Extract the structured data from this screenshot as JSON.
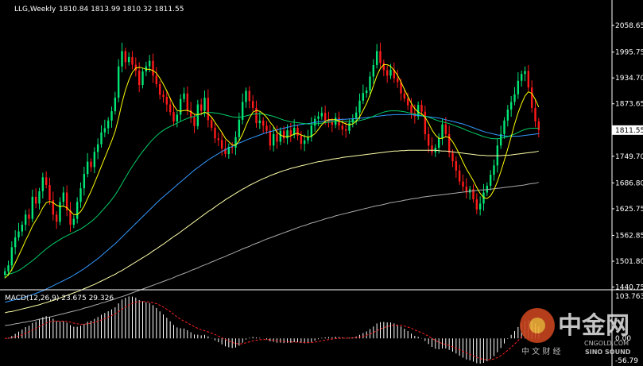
{
  "chart_data": {
    "type": "candlestick",
    "symbol": "LLG,Weekly",
    "ohlc_text": "1810.84 1813.99 1810.32 1811.55",
    "current_price_label": "1811.55",
    "price_ylim": [
      1440,
      2085
    ],
    "price_ticks": [
      "2058.65",
      "1995.75",
      "1934.70",
      "1873.65",
      "1749.70",
      "1686.80",
      "1625.75",
      "1562.85",
      "1501.80",
      "1440.75"
    ],
    "closes": [
      1478,
      1492,
      1535,
      1558,
      1572,
      1588,
      1612,
      1602,
      1654,
      1638,
      1667,
      1700,
      1682,
      1646,
      1612,
      1595,
      1642,
      1664,
      1622,
      1588,
      1602,
      1642,
      1674,
      1708,
      1737,
      1724,
      1760,
      1778,
      1806,
      1816,
      1834,
      1856,
      1888,
      1962,
      1998,
      1972,
      1984,
      1966,
      1952,
      1918,
      1950,
      1962,
      1975,
      1940,
      1920,
      1895,
      1890,
      1872,
      1854,
      1832,
      1848,
      1885,
      1898,
      1858,
      1842,
      1821,
      1872,
      1857,
      1888,
      1835,
      1817,
      1792,
      1788,
      1768,
      1755,
      1772,
      1770,
      1795,
      1836,
      1878,
      1904,
      1880,
      1864,
      1828,
      1834,
      1822,
      1810,
      1775,
      1802,
      1784,
      1810,
      1792,
      1811,
      1800,
      1817,
      1798,
      1779,
      1787,
      1795,
      1822,
      1838,
      1844,
      1852,
      1835,
      1832,
      1824,
      1841,
      1822,
      1813,
      1810,
      1829,
      1838,
      1853,
      1881,
      1899,
      1905,
      1938,
      1965,
      1998,
      1970,
      1953,
      1940,
      1954,
      1934,
      1925,
      1898,
      1886,
      1870,
      1852,
      1844,
      1871,
      1855,
      1802,
      1775,
      1759,
      1770,
      1793,
      1825,
      1802,
      1758,
      1738,
      1716,
      1690,
      1678,
      1664,
      1672,
      1648,
      1624,
      1638,
      1664,
      1680,
      1706,
      1728,
      1775,
      1802,
      1834,
      1860,
      1878,
      1896,
      1928,
      1944,
      1951,
      1912,
      1864,
      1832,
      1811.55
    ],
    "ma_short": [
      1462,
      1470,
      1482,
      1498,
      1515,
      1532,
      1551,
      1567,
      1585,
      1599,
      1612,
      1628,
      1640,
      1643,
      1640,
      1634,
      1631,
      1632,
      1628,
      1620,
      1612,
      1612,
      1619,
      1632,
      1650,
      1667,
      1686,
      1706,
      1726,
      1746,
      1766,
      1786,
      1808,
      1840,
      1876,
      1906,
      1930,
      1948,
      1958,
      1960,
      1958,
      1955,
      1955,
      1952,
      1946,
      1934,
      1920,
      1904,
      1886,
      1870,
      1858,
      1856,
      1858,
      1858,
      1855,
      1849,
      1848,
      1850,
      1854,
      1850,
      1842,
      1830,
      1818,
      1806,
      1792,
      1784,
      1776,
      1776,
      1786,
      1802,
      1822,
      1840,
      1854,
      1858,
      1856,
      1850,
      1842,
      1830,
      1820,
      1806,
      1800,
      1796,
      1796,
      1798,
      1802,
      1804,
      1800,
      1797,
      1795,
      1797,
      1803,
      1813,
      1824,
      1832,
      1836,
      1836,
      1836,
      1833,
      1830,
      1826,
      1824,
      1826,
      1832,
      1843,
      1858,
      1874,
      1894,
      1916,
      1940,
      1957,
      1966,
      1966,
      1962,
      1953,
      1941,
      1925,
      1908,
      1891,
      1875,
      1862,
      1854,
      1850,
      1842,
      1828,
      1812,
      1800,
      1792,
      1792,
      1796,
      1794,
      1784,
      1770,
      1754,
      1736,
      1720,
      1706,
      1692,
      1676,
      1662,
      1652,
      1650,
      1656,
      1670,
      1690,
      1714,
      1740,
      1767,
      1796,
      1826,
      1852,
      1874,
      1892,
      1902,
      1898,
      1884,
      1866
    ],
    "ma_medium": [
      1470,
      1471,
      1473,
      1476,
      1480,
      1485,
      1491,
      1497,
      1503,
      1510,
      1517,
      1524,
      1531,
      1537,
      1543,
      1548,
      1553,
      1558,
      1562,
      1566,
      1570,
      1574,
      1578,
      1583,
      1589,
      1595,
      1602,
      1610,
      1619,
      1628,
      1637,
      1647,
      1658,
      1671,
      1685,
      1699,
      1713,
      1726,
      1738,
      1750,
      1761,
      1771,
      1781,
      1790,
      1798,
      1805,
      1811,
      1816,
      1820,
      1824,
      1828,
      1832,
      1836,
      1839,
      1842,
      1844,
      1847,
      1849,
      1852,
      1853,
      1853,
      1852,
      1851,
      1849,
      1847,
      1845,
      1843,
      1842,
      1842,
      1843,
      1845,
      1847,
      1849,
      1850,
      1850,
      1849,
      1848,
      1846,
      1844,
      1841,
      1838,
      1835,
      1833,
      1831,
      1830,
      1829,
      1828,
      1827,
      1826,
      1826,
      1826,
      1827,
      1828,
      1829,
      1830,
      1831,
      1832,
      1832,
      1832,
      1832,
      1832,
      1832,
      1833,
      1834,
      1836,
      1838,
      1841,
      1844,
      1848,
      1851,
      1854,
      1856,
      1857,
      1857,
      1857,
      1856,
      1855,
      1853,
      1851,
      1849,
      1848,
      1846,
      1844,
      1842,
      1839,
      1836,
      1833,
      1831,
      1829,
      1827,
      1824,
      1821,
      1818,
      1815,
      1811,
      1808,
      1805,
      1802,
      1799,
      1796,
      1794,
      1792,
      1791,
      1791,
      1792,
      1794,
      1796,
      1799,
      1802,
      1806,
      1810,
      1813,
      1815,
      1816,
      1816,
      1816
    ],
    "ma_long1": [
      1405,
      1407,
      1409,
      1411,
      1413,
      1415,
      1418,
      1420,
      1423,
      1426,
      1429,
      1432,
      1436,
      1440,
      1444,
      1448,
      1452,
      1456,
      1460,
      1464,
      1469,
      1474,
      1479,
      1484,
      1490,
      1496,
      1502,
      1508,
      1515,
      1522,
      1529,
      1536,
      1543,
      1551,
      1559,
      1567,
      1575,
      1583,
      1591,
      1599,
      1607,
      1615,
      1623,
      1631,
      1639,
      1647,
      1654,
      1661,
      1668,
      1675,
      1682,
      1689,
      1696,
      1703,
      1710,
      1717,
      1723,
      1729,
      1735,
      1741,
      1746,
      1751,
      1756,
      1761,
      1765,
      1769,
      1773,
      1777,
      1781,
      1784,
      1788,
      1791,
      1794,
      1797,
      1800,
      1803,
      1806,
      1808,
      1810,
      1812,
      1814,
      1816,
      1818,
      1820,
      1822,
      1823,
      1825,
      1826,
      1827,
      1828,
      1830,
      1831,
      1832,
      1833,
      1834,
      1835,
      1836,
      1836,
      1837,
      1837,
      1838,
      1838,
      1839,
      1840,
      1840,
      1841,
      1842,
      1843,
      1844,
      1845,
      1846,
      1847,
      1847,
      1848,
      1848,
      1848,
      1848,
      1848,
      1848,
      1847,
      1846,
      1845,
      1844,
      1843,
      1842,
      1841,
      1840,
      1838,
      1836,
      1834,
      1832,
      1830,
      1828,
      1826,
      1823,
      1820,
      1817,
      1814,
      1811,
      1808,
      1806,
      1804,
      1802,
      1800,
      1799,
      1798,
      1797,
      1797,
      1797,
      1797,
      1798,
      1799,
      1800,
      1801,
      1802,
      1803
    ],
    "ma_long2": [
      1380,
      1382,
      1383,
      1385,
      1387,
      1389,
      1391,
      1393,
      1395,
      1397,
      1399,
      1402,
      1404,
      1407,
      1409,
      1412,
      1415,
      1418,
      1421,
      1424,
      1427,
      1430,
      1433,
      1437,
      1440,
      1444,
      1447,
      1451,
      1455,
      1459,
      1463,
      1467,
      1471,
      1476,
      1480,
      1485,
      1490,
      1495,
      1500,
      1505,
      1510,
      1515,
      1520,
      1526,
      1531,
      1537,
      1542,
      1548,
      1554,
      1560,
      1565,
      1571,
      1577,
      1583,
      1589,
      1595,
      1601,
      1607,
      1613,
      1619,
      1624,
      1630,
      1636,
      1641,
      1647,
      1652,
      1657,
      1662,
      1667,
      1672,
      1676,
      1681,
      1685,
      1689,
      1693,
      1697,
      1700,
      1704,
      1707,
      1710,
      1713,
      1716,
      1718,
      1721,
      1723,
      1725,
      1727,
      1729,
      1731,
      1733,
      1735,
      1737,
      1738,
      1740,
      1741,
      1743,
      1744,
      1745,
      1747,
      1748,
      1749,
      1750,
      1751,
      1752,
      1753,
      1754,
      1755,
      1756,
      1757,
      1758,
      1759,
      1760,
      1761,
      1762,
      1762,
      1763,
      1763,
      1764,
      1764,
      1764,
      1764,
      1764,
      1764,
      1764,
      1764,
      1764,
      1763,
      1762,
      1762,
      1761,
      1760,
      1759,
      1758,
      1757,
      1756,
      1755,
      1754,
      1753,
      1752,
      1752,
      1751,
      1751,
      1751,
      1751,
      1751,
      1752,
      1752,
      1753,
      1754,
      1755,
      1756,
      1757,
      1758,
      1759,
      1760,
      1762
    ],
    "ma_long3": [
      1350,
      1351,
      1352,
      1354,
      1355,
      1357,
      1358,
      1360,
      1361,
      1363,
      1365,
      1366,
      1368,
      1370,
      1372,
      1374,
      1376,
      1378,
      1380,
      1382,
      1384,
      1386,
      1388,
      1391,
      1393,
      1395,
      1398,
      1400,
      1403,
      1405,
      1408,
      1410,
      1413,
      1416,
      1418,
      1421,
      1424,
      1427,
      1430,
      1433,
      1436,
      1439,
      1442,
      1445,
      1448,
      1451,
      1454,
      1457,
      1460,
      1463,
      1467,
      1470,
      1473,
      1476,
      1480,
      1483,
      1486,
      1490,
      1493,
      1496,
      1500,
      1503,
      1507,
      1510,
      1513,
      1517,
      1520,
      1524,
      1527,
      1531,
      1534,
      1537,
      1541,
      1544,
      1547,
      1551,
      1554,
      1557,
      1560,
      1563,
      1566,
      1569,
      1572,
      1575,
      1578,
      1581,
      1584,
      1586,
      1589,
      1592,
      1594,
      1597,
      1599,
      1602,
      1604,
      1606,
      1609,
      1611,
      1613,
      1615,
      1617,
      1619,
      1621,
      1623,
      1625,
      1627,
      1629,
      1631,
      1633,
      1634,
      1636,
      1638,
      1640,
      1641,
      1643,
      1644,
      1646,
      1647,
      1649,
      1650,
      1651,
      1653,
      1654,
      1655,
      1656,
      1657,
      1658,
      1659,
      1660,
      1661,
      1662,
      1663,
      1664,
      1665,
      1666,
      1667,
      1668,
      1669,
      1670,
      1670,
      1671,
      1672,
      1673,
      1674,
      1675,
      1676,
      1677,
      1678,
      1679,
      1680,
      1681,
      1682,
      1684,
      1685,
      1686,
      1688
    ],
    "macd_label": "MACD(12,26,9) 23.675 29.326",
    "macd_ylim": [
      -56.79,
      103.763
    ],
    "macd_ticks": [
      "103.763",
      "0.00",
      "-56.79"
    ],
    "ma_colors": {
      "short": "#ffff00",
      "medium": "#00cc66",
      "long1": "#3399ff",
      "long2": "#ffffaa",
      "long3": "#aaaaaa"
    },
    "up_color": "#00e676",
    "down_color": "#ff1a1a",
    "signal_color": "#ff2222",
    "histogram_color": "#ffffff"
  },
  "watermark": {
    "brand": "中金网",
    "site": "CNGOLD.COM",
    "sub": "中 文 财 经",
    "partner": "SINO SOUND"
  }
}
